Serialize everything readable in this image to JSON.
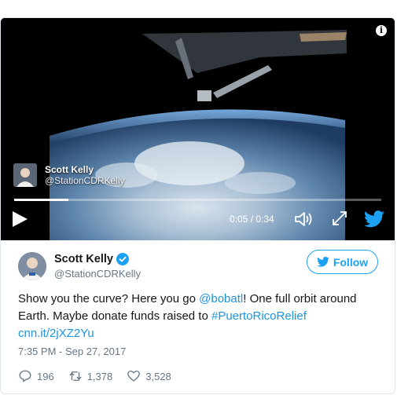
{
  "video": {
    "author_name": "Scott Kelly",
    "author_handle": "@StationCDRKelly",
    "time_display": "0:05 / 0:34",
    "progress": 0.147
  },
  "tweet": {
    "author_name": "Scott Kelly",
    "author_handle": "@StationCDRKelly",
    "follow_label": "Follow",
    "text_part1": "Show you the curve? Here you go ",
    "mention": "@bobatl",
    "text_part2": "! One full orbit around Earth. Maybe donate funds raised to ",
    "hashtag": "#PuertoRicoRelief",
    "link": "cnn.it/2jXZ2Yu",
    "timestamp": "7:35 PM - Sep 27, 2017"
  },
  "actions": {
    "replies": "196",
    "retweets": "1,378",
    "likes": "3,528"
  },
  "colors": {
    "accent": "#1da1f2",
    "link": "#1b95e0",
    "secondary": "#657786"
  },
  "icons": [
    "info-icon",
    "play-icon",
    "volume-icon",
    "fullscreen-icon",
    "twitter-bird-icon",
    "verified-icon",
    "reply-icon",
    "retweet-icon",
    "like-icon"
  ]
}
